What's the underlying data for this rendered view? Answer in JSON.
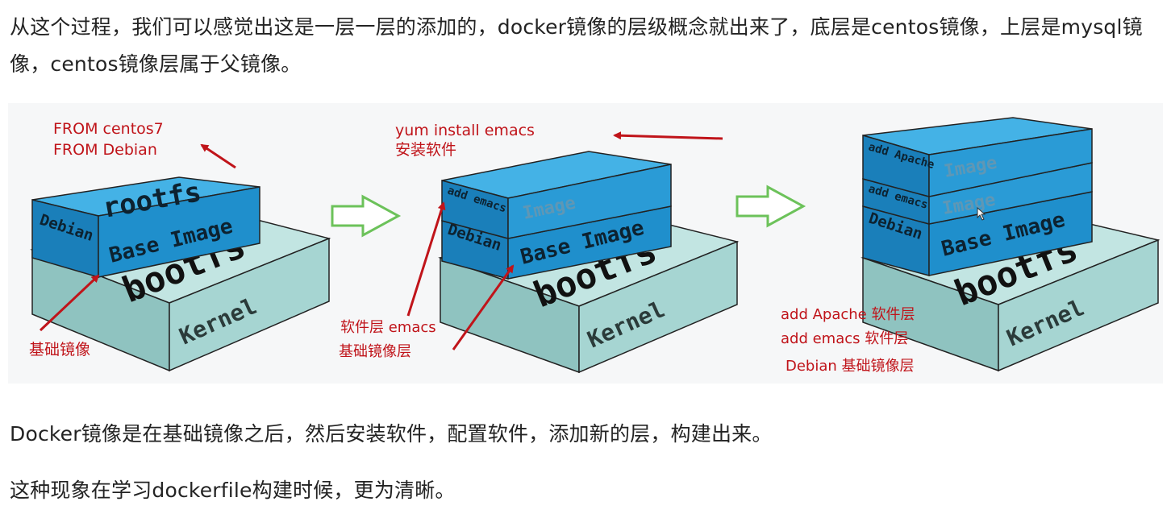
{
  "paragraphs": {
    "intro": "从这个过程，我们可以感觉出这是一层一层的添加的，docker镜像的层级概念就出来了，底层是centos镜像，上层是mysql镜像，centos镜像层属于父镜像。",
    "build": "Docker镜像是在基础镜像之后，然后安装软件，配置软件，添加新的层，构建出来。",
    "dockerfile": "这种现象在学习dockerfile构建时候，更为清晰。"
  },
  "diagram": {
    "stack1": {
      "kernel": "Kernel",
      "bootfs": "bootfs",
      "rootfs": "rootfs",
      "debian": "Debian",
      "base_image": "Base Image",
      "note_from_1": "FROM centos7",
      "note_from_2": "FROM Debian",
      "note_base": "基础镜像"
    },
    "stack2": {
      "kernel": "Kernel",
      "bootfs": "bootfs",
      "debian": "Debian",
      "base_image": "Base Image",
      "add_emacs": "add emacs",
      "image": "Image",
      "note_yum": "yum install emacs",
      "note_install": "安装软件",
      "note_layer_1": "软件层 emacs",
      "note_layer_2": "基础镜像层"
    },
    "stack3": {
      "kernel": "Kernel",
      "bootfs": "bootfs",
      "debian": "Debian",
      "base_image": "Base Image",
      "add_emacs": "add emacs",
      "add_apache": "add Apache",
      "image_1": "Image",
      "image_2": "Image",
      "note_1": "add Apache 软件层",
      "note_2": "add emacs 软件层",
      "note_3": "Debian 基础镜像层"
    },
    "colors": {
      "kernel_face": "#a6d5d2",
      "kernel_top": "#c2e5e2",
      "kernel_side": "#8fc3c0",
      "layer_face": "#1f8fcc",
      "layer_top": "#44b2e6",
      "layer_side": "#1a7fba",
      "annotation": "#c0141a",
      "arrow_green": "#6cc25a"
    }
  }
}
